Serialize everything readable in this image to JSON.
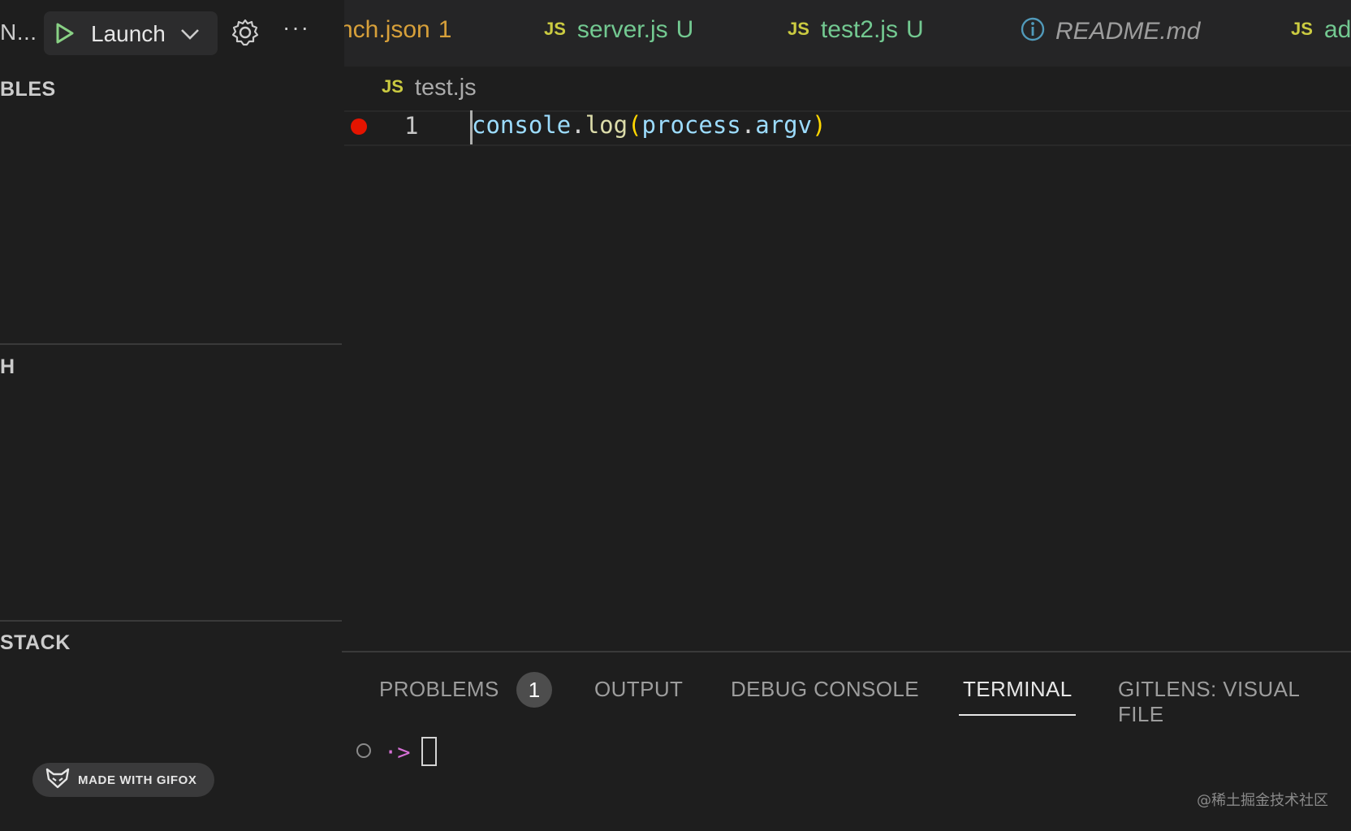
{
  "debug_toolbar": {
    "title_truncated": "N...",
    "config_name": "Launch"
  },
  "sidebar": {
    "sections": [
      {
        "title": "BLES"
      },
      {
        "title": "H"
      },
      {
        "title": "STACK"
      }
    ]
  },
  "tabs": [
    {
      "name": "nch.json",
      "flag": "1",
      "icon": "js-badge-hidden"
    },
    {
      "icon_label": "JS",
      "name": "server.js",
      "flag": "U"
    },
    {
      "icon_label": "JS",
      "name": "test2.js",
      "flag": "U"
    },
    {
      "icon": "info-icon",
      "name": "README.md"
    },
    {
      "icon_label": "JS",
      "name": "ad"
    }
  ],
  "editor": {
    "breadcrumb_icon": "JS",
    "breadcrumb_file": "test.js",
    "line_number": "1",
    "code_tokens": [
      "console",
      ".",
      "log",
      "(",
      "process",
      ".",
      "argv",
      ")"
    ]
  },
  "panel": {
    "tabs": [
      {
        "label": "PROBLEMS",
        "badge": "1"
      },
      {
        "label": "OUTPUT"
      },
      {
        "label": "DEBUG CONSOLE"
      },
      {
        "label": "TERMINAL",
        "active": true
      },
      {
        "label": "GITLENS: VISUAL FILE"
      }
    ],
    "terminal_prompt": "·>"
  },
  "overlay": {
    "gifox_label": "MADE WITH GIFOX",
    "watermark": "@稀土掘金技术社区"
  },
  "colors": {
    "js_badge": "#cbcb41",
    "untracked": "#73c991",
    "warning": "#d7a03a",
    "breakpoint": "#e51400",
    "prompt": "#d670d6"
  }
}
